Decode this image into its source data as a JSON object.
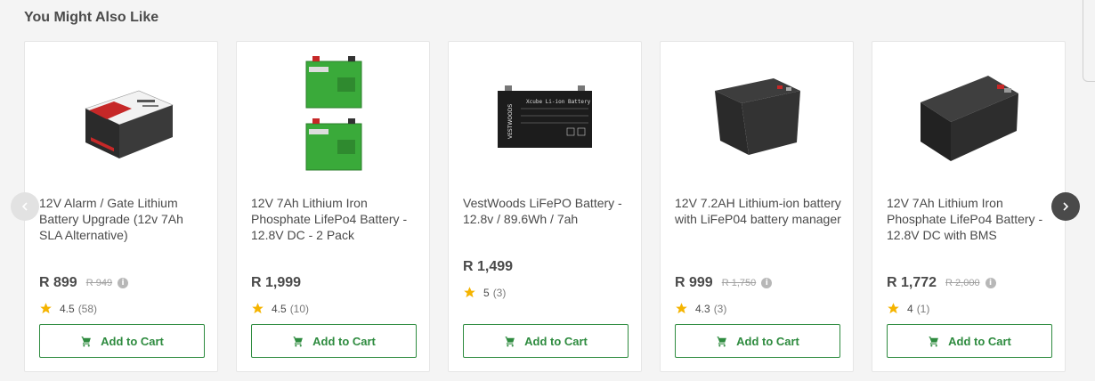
{
  "section": {
    "title": "You Might Also Like"
  },
  "products": [
    {
      "title": "12V Alarm / Gate Lithium Battery Upgrade (12v 7Ah SLA Alternative)",
      "price": "R 899",
      "old_price": "R 949",
      "rating": "4.5",
      "reviews": "(58)",
      "cta": "Add to Cart"
    },
    {
      "title": "12V 7Ah Lithium Iron Phosphate LifePo4 Battery - 12.8V DC - 2 Pack",
      "price": "R 1,999",
      "old_price": "",
      "rating": "4.5",
      "reviews": "(10)",
      "cta": "Add to Cart"
    },
    {
      "title": "VestWoods LiFePO Battery - 12.8v / 89.6Wh / 7ah",
      "price": "R 1,499",
      "old_price": "",
      "rating": "5",
      "reviews": "(3)",
      "cta": "Add to Cart",
      "image_label": "Xcube Li-ion Battery",
      "image_brand": "VESTWOODS"
    },
    {
      "title": "12V 7.2AH Lithium-ion battery with LiFeP04 battery manager",
      "price": "R 999",
      "old_price": "R 1,750",
      "rating": "4.3",
      "reviews": "(3)",
      "cta": "Add to Cart"
    },
    {
      "title": "12V 7Ah Lithium Iron Phosphate LifePo4 Battery - 12.8V DC with BMS",
      "price": "R 1,772",
      "old_price": "R 2,000",
      "rating": "4",
      "reviews": "(1)",
      "cta": "Add to Cart"
    }
  ],
  "icons": {
    "star": "star-icon",
    "cart": "cart-icon",
    "info": "info-icon",
    "prev": "chevron-left-icon",
    "next": "chevron-right-icon"
  },
  "colors": {
    "accent": "#2e8b3f",
    "star": "#f5b400",
    "text": "#4a4a4a"
  }
}
